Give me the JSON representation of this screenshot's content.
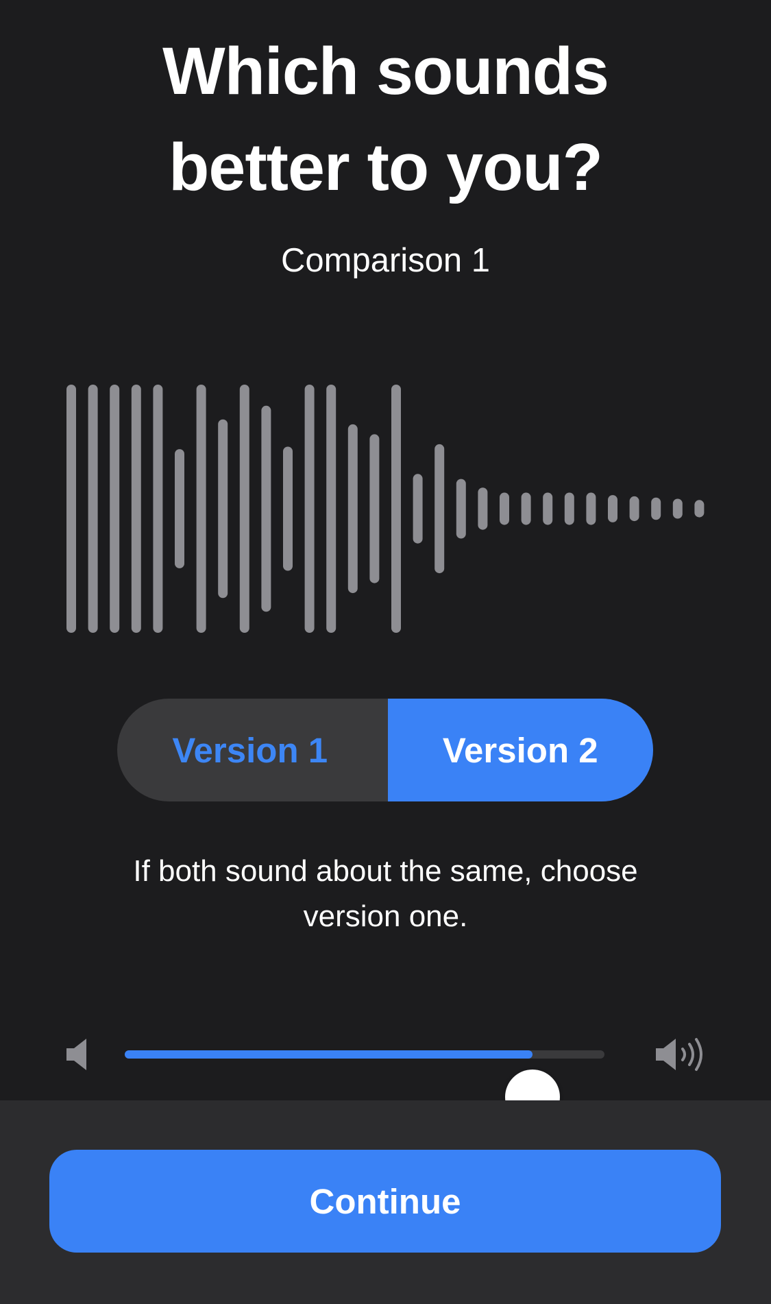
{
  "header": {
    "title_line1": "Which sounds",
    "title_line2": "better to you?",
    "subtitle": "Comparison 1"
  },
  "waveform": {
    "icon": "audio-waveform",
    "bar_levels": [
      1.0,
      1.0,
      1.0,
      1.0,
      1.0,
      0.48,
      1.0,
      0.72,
      1.0,
      0.83,
      0.5,
      1.0,
      1.0,
      0.68,
      0.6,
      1.0,
      0.28,
      0.52,
      0.24,
      0.17,
      0.13,
      0.13,
      0.13,
      0.13,
      0.13,
      0.11,
      0.1,
      0.09,
      0.08,
      0.07
    ]
  },
  "selector": {
    "options": [
      "Version 1",
      "Version 2"
    ],
    "selected_index": 1
  },
  "hint": {
    "line1": "If both sound about the same, choose",
    "line2": "version one."
  },
  "volume": {
    "level": 0.85,
    "low_icon": "speaker-low-icon",
    "high_icon": "speaker-high-icon"
  },
  "footer": {
    "continue_label": "Continue"
  },
  "colors": {
    "background": "#1c1c1e",
    "accent": "#3a82f6",
    "segment_unselected_bg": "#3a3a3c",
    "waveform": "#8e8e93",
    "footer_bg": "#2c2c2e"
  }
}
